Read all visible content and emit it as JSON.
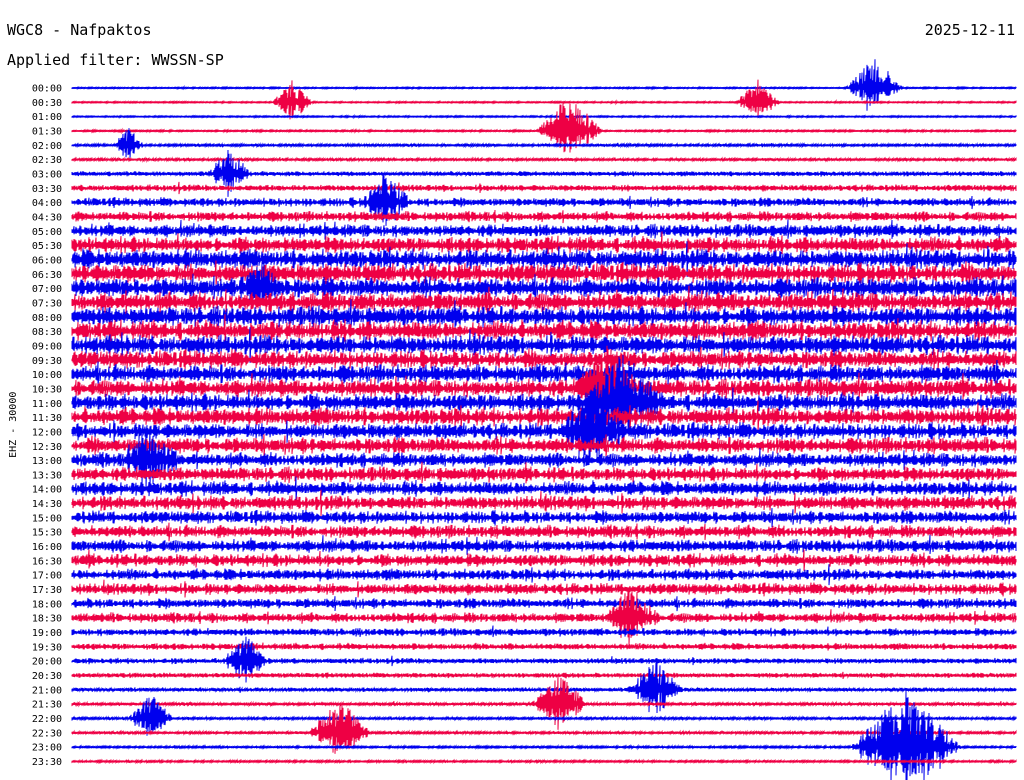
{
  "header": {
    "station": "WGC8 - Nafpaktos",
    "date": "2025-12-11",
    "filter": "Applied filter: WWSSN-SP"
  },
  "chart_data": {
    "type": "line",
    "title": "WGC8 - Nafpaktos",
    "ylabel": "EHZ - 30000",
    "xlabel": "",
    "row_labels": [
      "00:00",
      "00:30",
      "01:00",
      "01:30",
      "02:00",
      "02:30",
      "03:00",
      "03:30",
      "04:00",
      "04:30",
      "05:00",
      "05:30",
      "06:00",
      "06:30",
      "07:00",
      "07:30",
      "08:00",
      "08:30",
      "09:00",
      "09:30",
      "10:00",
      "10:30",
      "11:00",
      "11:30",
      "12:00",
      "12:30",
      "13:00",
      "13:30",
      "14:00",
      "14:30",
      "15:00",
      "15:30",
      "16:00",
      "16:30",
      "17:00",
      "17:30",
      "18:00",
      "18:30",
      "19:00",
      "19:30",
      "20:00",
      "20:30",
      "21:00",
      "21:30",
      "22:00",
      "22:30",
      "23:00",
      "23:30"
    ],
    "row_colors": [
      "#0000ee",
      "#ee0044"
    ],
    "activity_level": [
      0.15,
      0.15,
      0.15,
      0.2,
      0.3,
      0.3,
      0.45,
      0.55,
      0.65,
      0.7,
      0.8,
      0.9,
      1.0,
      1.0,
      1.0,
      1.0,
      1.0,
      1.0,
      1.0,
      0.95,
      0.95,
      0.95,
      0.95,
      0.95,
      0.9,
      0.9,
      0.85,
      0.85,
      0.85,
      0.85,
      0.8,
      0.8,
      0.8,
      0.8,
      0.75,
      0.75,
      0.7,
      0.7,
      0.6,
      0.55,
      0.5,
      0.45,
      0.4,
      0.35,
      0.3,
      0.3,
      0.25,
      0.25
    ],
    "events": [
      {
        "row": 0,
        "minute": 25.5,
        "amplitude": 2.6
      },
      {
        "row": 1,
        "minute": 7,
        "amplitude": 1.8
      },
      {
        "row": 1,
        "minute": 21.8,
        "amplitude": 2.0
      },
      {
        "row": 3,
        "minute": 15.8,
        "amplitude": 3.0
      },
      {
        "row": 4,
        "minute": 1.8,
        "amplitude": 1.4
      },
      {
        "row": 6,
        "minute": 5,
        "amplitude": 2.0
      },
      {
        "row": 8,
        "minute": 10,
        "amplitude": 2.2
      },
      {
        "row": 14,
        "minute": 6,
        "amplitude": 2.0
      },
      {
        "row": 21,
        "minute": 17,
        "amplitude": 3.0
      },
      {
        "row": 22,
        "minute": 17.5,
        "amplitude": 3.5
      },
      {
        "row": 24,
        "minute": 16.5,
        "amplitude": 3.0
      },
      {
        "row": 26,
        "minute": 2.5,
        "amplitude": 2.5
      },
      {
        "row": 37,
        "minute": 17.8,
        "amplitude": 2.4
      },
      {
        "row": 40,
        "minute": 5.5,
        "amplitude": 2.0
      },
      {
        "row": 42,
        "minute": 18.5,
        "amplitude": 2.5
      },
      {
        "row": 43,
        "minute": 15.5,
        "amplitude": 2.5
      },
      {
        "row": 44,
        "minute": 2.5,
        "amplitude": 2.0
      },
      {
        "row": 45,
        "minute": 8.5,
        "amplitude": 2.8
      },
      {
        "row": 46,
        "minute": 26.5,
        "amplitude": 5.0
      }
    ]
  }
}
